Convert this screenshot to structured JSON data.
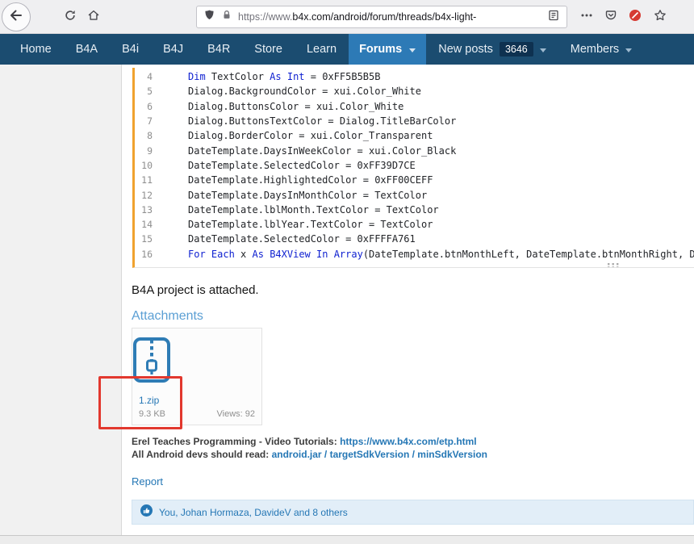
{
  "browser": {
    "url": {
      "protocol": "https://www.",
      "path": "b4x.com/android/forum/threads/b4x-light-"
    }
  },
  "nav": {
    "items": [
      "Home",
      "B4A",
      "B4i",
      "B4J",
      "B4R",
      "Store",
      "Learn"
    ],
    "forums": "Forums",
    "new_posts": "New posts",
    "new_posts_badge": "3646",
    "members": "Members"
  },
  "code_block": {
    "lines": [
      {
        "n": "4",
        "seg": [
          [
            "k",
            "Dim"
          ],
          [
            "p",
            " TextColor "
          ],
          [
            "k",
            "As"
          ],
          [
            "p",
            " "
          ],
          [
            "k",
            "Int"
          ],
          [
            "p",
            " = 0xFF5B5B5B"
          ]
        ]
      },
      {
        "n": "5",
        "seg": [
          [
            "p",
            "Dialog.BackgroundColor = xui.Color_White"
          ]
        ]
      },
      {
        "n": "6",
        "seg": [
          [
            "p",
            "Dialog.ButtonsColor = xui.Color_White"
          ]
        ]
      },
      {
        "n": "7",
        "seg": [
          [
            "p",
            "Dialog.ButtonsTextColor = Dialog.TitleBarColor"
          ]
        ]
      },
      {
        "n": "8",
        "seg": [
          [
            "p",
            "Dialog.BorderColor = xui.Color_Transparent"
          ]
        ]
      },
      {
        "n": "9",
        "seg": [
          [
            "p",
            "DateTemplate.DaysInWeekColor = xui.Color_Black"
          ]
        ]
      },
      {
        "n": "10",
        "seg": [
          [
            "p",
            "DateTemplate.SelectedColor = 0xFF39D7CE"
          ]
        ]
      },
      {
        "n": "11",
        "seg": [
          [
            "p",
            "DateTemplate.HighlightedColor = 0xFF00CEFF"
          ]
        ]
      },
      {
        "n": "12",
        "seg": [
          [
            "p",
            "DateTemplate.DaysInMonthColor = TextColor"
          ]
        ]
      },
      {
        "n": "13",
        "seg": [
          [
            "p",
            "DateTemplate.lblMonth.TextColor = TextColor"
          ]
        ]
      },
      {
        "n": "14",
        "seg": [
          [
            "p",
            "DateTemplate.lblYear.TextColor = TextColor"
          ]
        ]
      },
      {
        "n": "15",
        "seg": [
          [
            "p",
            "DateTemplate.SelectedColor = 0xFFFFA761"
          ]
        ]
      },
      {
        "n": "16",
        "seg": [
          [
            "k",
            "For"
          ],
          [
            "p",
            " "
          ],
          [
            "k",
            "Each"
          ],
          [
            "p",
            " x "
          ],
          [
            "k",
            "As"
          ],
          [
            "p",
            " "
          ],
          [
            "k",
            "B4XView"
          ],
          [
            "p",
            " "
          ],
          [
            "k",
            "In"
          ],
          [
            "p",
            " "
          ],
          [
            "k",
            "Array"
          ],
          [
            "p",
            "(DateTemplate.btnMonthLeft, DateTemplate.btnMonthRight, Date"
          ]
        ]
      }
    ]
  },
  "post": {
    "body": "B4A project is attached."
  },
  "attachments": {
    "heading": "Attachments",
    "file": {
      "name": "1.zip",
      "size": "9.3 KB",
      "views": "Views: 92"
    }
  },
  "signature": {
    "line1_text": "Erel Teaches Programming - Video Tutorials: ",
    "line1_link": "https://www.b4x.com/etp.html",
    "line2_text": "All Android devs should read: ",
    "line2_link": "android.jar / targetSdkVersion / minSdkVersion"
  },
  "actions": {
    "report": "Report"
  },
  "reactions": {
    "summary": "You, Johan Hormaza, DavideV and 8 others"
  },
  "colors": {
    "nav_bg": "#1b4c70",
    "nav_active": "#2d7ab6",
    "link": "#2577b5",
    "code_keyword": "#0d1fd0",
    "code_accent": "#f0a22e",
    "annotation_red": "#e2382e"
  }
}
